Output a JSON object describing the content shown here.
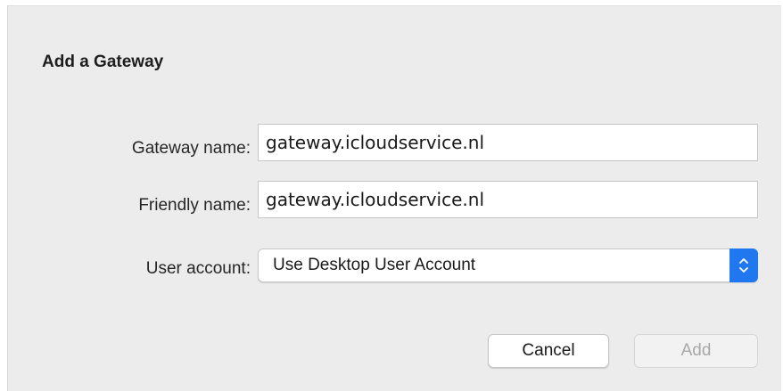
{
  "dialog": {
    "title": "Add a Gateway",
    "gateway_name": {
      "label": "Gateway name:",
      "value": "gateway.icloudservice.nl"
    },
    "friendly_name": {
      "label": "Friendly name:",
      "value": "gateway.icloudservice.nl"
    },
    "user_account": {
      "label": "User account:",
      "selected": "Use Desktop User Account",
      "icon": "up-down-chevron-icon"
    },
    "buttons": {
      "cancel": "Cancel",
      "add": "Add"
    }
  },
  "colors": {
    "dialog_background": "#ececec",
    "accent": "#1f78f0",
    "disabled_text": "#a8a8a8"
  }
}
